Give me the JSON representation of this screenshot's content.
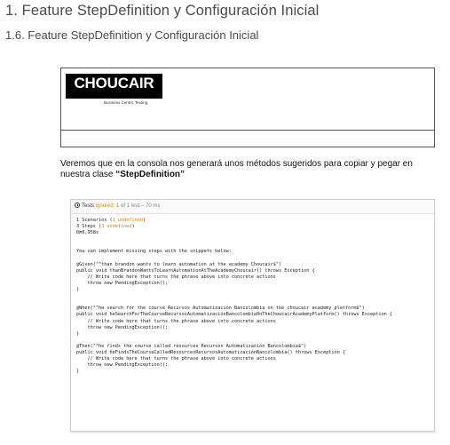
{
  "heading1": "1. Feature StepDefinition y Configuración Inicial",
  "heading2": "1.6. Feature StepDefinition y Configuración Inicial",
  "logo": {
    "name": "CHOUCAIR",
    "tagline": "Business Centric Testing"
  },
  "paragraph": {
    "text": "Veremos que en la consola nos generará unos métodos sugeridos para copiar y pegar en nuestra clase ",
    "bold": "“StepDefinition”"
  },
  "console": {
    "header": {
      "prefix": "Tests",
      "status": "ignored:",
      "summary": "1 of 1 test – 70 ms"
    },
    "lines": [
      [
        {
          "t": "1 Scenarios ("
        },
        {
          "t": "1 undefined",
          "c": "y"
        },
        {
          "t": ")"
        }
      ],
      [
        {
          "t": "3 Steps ("
        },
        {
          "t": "3 undefined",
          "c": "y"
        },
        {
          "t": ")"
        }
      ],
      [
        {
          "t": "0m0,958s"
        }
      ],
      [
        {
          "t": ""
        }
      ],
      [
        {
          "t": ""
        }
      ],
      [
        {
          "t": "You can implement missing steps with the snippets below:"
        }
      ],
      [
        {
          "t": ""
        }
      ],
      [
        {
          "t": "@Given(\"^than brandon wants to learn automation at the academy Choucair$\")"
        }
      ],
      [
        {
          "t": "public void thanBrandonWantsToLearnAutomationAtTheAcademyChoucair() throws Exception {"
        }
      ],
      [
        {
          "t": "    // Write code here that turns the phrase above into concrete actions"
        }
      ],
      [
        {
          "t": "    throw new PendingException();"
        }
      ],
      [
        {
          "t": "}"
        }
      ],
      [
        {
          "t": ""
        }
      ],
      [
        {
          "t": ""
        }
      ],
      [
        {
          "t": "@When(\"^he search for the course Recursos Automatización Bancolombia on the choucair academy platform$\")"
        }
      ],
      [
        {
          "t": "public void heSearchForTheCourseRecursosAutomatizaciónBancolombiaOnTheChoucairAcademyPlatform() throws Exception {"
        }
      ],
      [
        {
          "t": "    // Write code here that turns the phrase above into concrete actions"
        }
      ],
      [
        {
          "t": "    throw new PendingException();"
        }
      ],
      [
        {
          "t": "}"
        }
      ],
      [
        {
          "t": ""
        }
      ],
      [
        {
          "t": "@Then(\"^he finds the course called resources Recursos Automatización Bancolombia$\")"
        }
      ],
      [
        {
          "t": "public void heFindsTheCourseCalledResourcesRecursosAutomatizaciónBancolombia() throws Exception {"
        }
      ],
      [
        {
          "t": "    // Write code here that turns the phrase above into concrete actions"
        }
      ],
      [
        {
          "t": "    throw new PendingException();"
        }
      ],
      [
        {
          "t": "}"
        }
      ]
    ]
  },
  "colors": {
    "ignored": "#d59a00",
    "undefined": "#c98a00",
    "heading": "#4a4a4a"
  }
}
